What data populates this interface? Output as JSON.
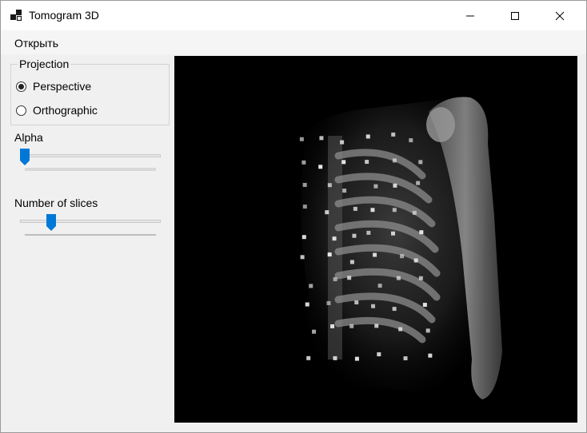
{
  "window": {
    "title": "Tomogram 3D",
    "icon": "app-cubes-icon",
    "controls": [
      "minimize-icon",
      "maximize-icon",
      "close-icon"
    ]
  },
  "menu": {
    "open_label": "Открыть"
  },
  "projection": {
    "group_label": "Projection",
    "options": [
      {
        "label": "Perspective",
        "checked": true
      },
      {
        "label": "Orthographic",
        "checked": false
      }
    ]
  },
  "alpha": {
    "label": "Alpha",
    "value_fraction": 0.0
  },
  "slices": {
    "label": "Number of slices",
    "value_fraction": 0.2
  },
  "colors": {
    "accent": "#0078d7",
    "viewport_bg": "#000000",
    "window_bg": "#f0f0f0"
  }
}
